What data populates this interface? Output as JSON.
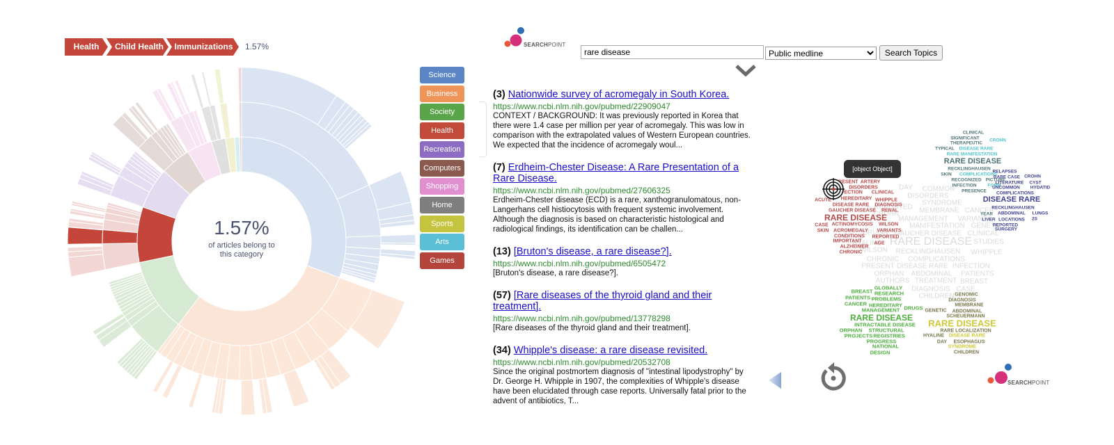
{
  "breadcrumb": {
    "items": [
      "Health",
      "Child Health",
      "Immunizations"
    ],
    "percentage": "1.57%",
    "color": "#c4463a"
  },
  "center_label": {
    "value": "1.57%",
    "caption_line1": "of articles belong to",
    "caption_line2": "this category"
  },
  "legend": [
    {
      "label": "Science",
      "color": "#5a86c5"
    },
    {
      "label": "Business",
      "color": "#f0955a"
    },
    {
      "label": "Society",
      "color": "#5aa54a"
    },
    {
      "label": "Health",
      "color": "#c24a3a"
    },
    {
      "label": "Recreation",
      "color": "#8d6dc4"
    },
    {
      "label": "Computers",
      "color": "#8a5a4e"
    },
    {
      "label": "Shopping",
      "color": "#e28fcf"
    },
    {
      "label": "Home",
      "color": "#7f7f7f"
    },
    {
      "label": "Sports",
      "color": "#c5c43e"
    },
    {
      "label": "Arts",
      "color": "#5bc0d6"
    },
    {
      "label": "Games",
      "color": "#b5443c"
    }
  ],
  "chart_data": {
    "type": "sunburst",
    "unit": "% of articles",
    "highlighted_path": [
      "Health",
      "Child Health",
      "Immunizations"
    ],
    "highlighted_value": 1.57,
    "categories": [
      {
        "name": "Science",
        "value": 30.7,
        "children": [
          {
            "v": 18.4,
            "c": [
              9.2,
              1.0,
              0.5,
              0.5,
              0.5,
              0.4,
              0.4,
              0.4,
              0.3,
              0.3
            ]
          },
          {
            "v": 6.0,
            "c": [
              3.0,
              1.2,
              0.5,
              0.4
            ]
          },
          {
            "v": 1.5,
            "c": [
              0.8,
              0.2
            ]
          },
          {
            "v": 1.0,
            "c": [
              0.5,
              0.3
            ]
          },
          0.8,
          0.7,
          0.5,
          0.4,
          0.3,
          0.3
        ]
      },
      {
        "name": "Business",
        "value": 29.7,
        "children": [
          {
            "v": 5.5,
            "c": [
              5.0
            ]
          },
          3.0,
          {
            "v": 2.5,
            "c": [
              1.2,
              0.6,
              0.4
            ]
          },
          2.0,
          {
            "v": 1.8,
            "c": [
              1.5
            ]
          },
          1.7,
          {
            "v": 1.6,
            "c": [
              0.5,
              0.4
            ]
          },
          {
            "v": 1.5,
            "c": [
              1.3
            ]
          },
          1.5,
          {
            "v": 1.4,
            "c": [
              0.4,
              0.3,
              0.3
            ]
          },
          1.4,
          {
            "v": 1.3,
            "c": [
              0.4
            ]
          },
          1.2,
          {
            "v": 1.1,
            "c": [
              0.5
            ]
          },
          {
            "v": 1.0,
            "c": [
              0.4
            ]
          },
          0.8,
          0.6,
          0.5,
          0.4,
          0.3,
          0.3,
          0.3,
          0.2,
          0.2
        ]
      },
      {
        "name": "Society",
        "value": 11.4,
        "children": [
          {
            "v": 4.2,
            "c": [
              0.3,
              0.3,
              0.3,
              0.3,
              0.3,
              0.3,
              0.3,
              0.3
            ]
          },
          {
            "v": 0.8,
            "c": [
              0.8
            ]
          },
          {
            "v": 0.6,
            "c": [
              0.5
            ]
          },
          {
            "v": 0.5,
            "c": [
              0.4
            ]
          },
          0.4,
          0.4,
          0.4,
          0.4,
          0.4,
          0.3,
          0.3,
          0.3,
          0.3,
          0.3,
          0.3
        ]
      },
      {
        "name": "Health",
        "value": 8.6,
        "hl": true,
        "children": [
          {
            "v": 3.0,
            "c": [
              1.8,
              0.5,
              0.4
            ]
          },
          {
            "v": 1.6,
            "hl": true,
            "c": [
              {
                "v": 1.57,
                "hl": true
              }
            ]
          },
          {
            "v": 1.2,
            "c": [
              0.5,
              0.3
            ]
          },
          {
            "v": 0.8,
            "c": [
              0.3,
              0.2
            ]
          },
          {
            "v": 0.6,
            "c": [
              0.2,
              0.2
            ]
          },
          0.3,
          0.3
        ]
      },
      {
        "name": "Recreation",
        "value": 6.4,
        "children": [
          {
            "v": 2.5,
            "c": [
              0.6,
              0.4,
              0.3
            ]
          },
          {
            "v": 1.2,
            "c": [
              0.3,
              0.3,
              0.2
            ]
          },
          0.6,
          0.5,
          0.4,
          0.4,
          0.3
        ]
      },
      {
        "name": "Computers",
        "value": 4.7,
        "children": [
          {
            "v": 2.0,
            "c": [
              1.2,
              0.4
            ]
          },
          {
            "v": 0.8,
            "c": [
              0.3,
              0.3
            ]
          },
          {
            "v": 0.5,
            "c": [
              0.3
            ]
          },
          0.4,
          0.4,
          0.3
        ]
      },
      {
        "name": "Shopping",
        "value": 3.9,
        "children": [
          {
            "v": 1.5,
            "c": [
              0.5,
              0.3
            ]
          },
          {
            "v": 0.8,
            "c": [
              0.4,
              0.2
            ]
          },
          {
            "v": 0.6,
            "c": [
              0.3
            ]
          },
          0.4
        ]
      },
      {
        "name": "Home",
        "value": 2.2,
        "children": [
          {
            "v": 1.0,
            "c": [
              0.3
            ]
          },
          {
            "v": 0.6,
            "c": [
              0.2
            ]
          }
        ]
      },
      {
        "name": "Sports",
        "value": 1.4,
        "children": [
          {
            "v": 0.8,
            "c": [
              0.5
            ]
          }
        ]
      },
      {
        "name": "Arts",
        "value": 0.8,
        "children": []
      },
      {
        "name": "Games",
        "value": 0.3,
        "children": [
          {
            "v": 0.3,
            "c": [
              0.3
            ]
          }
        ]
      }
    ]
  },
  "search": {
    "logo_text_bold": "SEARCH",
    "logo_text": "POINT",
    "query": "rare disease",
    "source": "Public medline",
    "button_label": "Search Topics"
  },
  "results": [
    {
      "rank": "(3)",
      "title": "Nationwide survey of acromegaly in South Korea.",
      "url": "https://www.ncbi.nlm.nih.gov/pubmed/22909047",
      "snippet": "CONTEXT / BACKGROUND: It was previously reported in Korea that there were 1.4 case per million per year of acromegaly. This was low in comparison with the extrapolated values of Western European countries. We expected that the incidence of acromegaly woul..."
    },
    {
      "rank": "(7)",
      "title": "Erdheim-Chester Disease: A Rare Presentation of a Rare Disease.",
      "url": "https://www.ncbi.nlm.nih.gov/pubmed/27606325",
      "snippet": "Erdheim-Chester disease (ECD) is a rare, xanthogranulomatous, non-Langerhans cell histiocytosis with frequent systemic involvement. Although the diagnosis is based on characteristic histological and radiological findings, its identification can be challen..."
    },
    {
      "rank": "(13)",
      "title": "[Bruton's disease, a rare disease?].",
      "url": "https://www.ncbi.nlm.nih.gov/pubmed/6505472",
      "snippet": "[Bruton's disease, a rare disease?]."
    },
    {
      "rank": "(57)",
      "title": "[Rare diseases of the thyroid gland and their treatment].",
      "url": "https://www.ncbi.nlm.nih.gov/pubmed/13778298",
      "snippet": "[Rare diseases of the thyroid gland and their treatment]."
    },
    {
      "rank": "(34)",
      "title": "Whipple's disease: a rare disease revisited.",
      "url": "https://www.ncbi.nlm.nih.gov/pubmed/20532708",
      "snippet": "Since the original postmortem diagnosis of \"intestinal lipodystrophy\" by Dr. George H. Whipple in 1907, the complexities of Whipple's disease have been elucidated through case reports. Universally fatal prior to the advent of antibiotics, T..."
    }
  ],
  "word_cloud": {
    "tooltip": "[object Object]",
    "colors": {
      "gray": "#dadada",
      "red": "#b84a4a",
      "green": "#4cae3c",
      "olive": "#77774a",
      "yellow": "#cfc93a",
      "teal": "#4e7272",
      "cyan": "#4cc4cc",
      "blue": "#3d3f92"
    },
    "gray": [
      "DAY",
      "COMMON",
      "DISORDERS",
      "SYNDROME",
      "MEMBRANE",
      "MANAGEMENT",
      "CANCER",
      "VARIANTS",
      "MANIFESTATION",
      "GENETIC",
      "GAUCHER DISEASE",
      "CLINICAL",
      "RARE DISEASE",
      "STUDIES",
      "RECKLINGHAUSEN",
      "WHIPPLE",
      "REPORTED",
      "CROHN",
      "DRUGS",
      "HYALINE",
      "WILSON",
      "CHRONIC",
      "COMPLICATIONS",
      "PRESENT",
      "DISEASE RARE",
      "INFECTION",
      "ORPHAN",
      "ABDOMINAL",
      "PATIENTS",
      "AUTHORS",
      "TREATMENT",
      "BREAST",
      "DIAGNOSIS",
      "CASE",
      "CHILDREN"
    ],
    "red": [
      "PRESENT",
      "ARTERY",
      "DISORDERS",
      "INFECTION",
      "CLINICAL",
      "ACUTE",
      "HEREDITARY",
      "WHIPPLE",
      "DISEASE RARE",
      "DIAGNOSIS",
      "GAUCHER DISEASE",
      "RENAL",
      "RARE DISEASE",
      "CASE",
      "ACTINOMYCOSIS",
      "WILSON",
      "SKIN",
      "ACROMEGALY",
      "VARIANTS",
      "CONDITIONS",
      "REPORTED",
      "IMPORTANT",
      "AGE",
      "ALZHEIMER",
      "CHRONIC"
    ],
    "green": [
      "GLOBALLY",
      "BREAST",
      "RESEARCH",
      "PATIENTS",
      "PROBLEMS",
      "CANCER",
      "HEREDITARY",
      "DRUGS",
      "MANAGEMENT",
      "RARE DISEASE",
      "INTRACTABLE DISEASE",
      "ORPHAN",
      "STRUCTURAL",
      "PROJECTS",
      "REGISTRIES",
      "PROGRESS",
      "NATIONAL",
      "DESIGN"
    ],
    "olive": [
      "GENOMIC",
      "DIAGNOSIS",
      "MEMBRANE",
      "GENETIC",
      "ABDOMINAL",
      "SCHEUERMANN",
      "RARE DISEASE",
      "RARE LOCALIZATION",
      "HYALINE",
      "DISEASE RARE",
      "DAY",
      "ESOPHAGUS",
      "SYNDROME",
      "CHILDREN"
    ],
    "teal": [
      "CLINICAL",
      "SIGNIFICANT",
      "CROHN",
      "THERAPEUTIC",
      "TYPICAL",
      "DISEASE RARE",
      "RARE MANIFESTATION",
      "RARE DISEASE",
      "RECKLINGHAUSEN",
      "SKIN",
      "COMPLICATIONS",
      "RECOGNIZED",
      "PICTURE",
      "INFECTION",
      "FORM",
      "PRESENCE"
    ],
    "blue": [
      "RELAPSES",
      "RARE CASE",
      "CROHN",
      "LITERATURE",
      "CYST",
      "UNCOMMON",
      "HYDATID",
      "COMPLICATIONS",
      "DISEASE RARE",
      "RECKLINGHAUSEN",
      "YEAR",
      "ABDOMINAL",
      "LUNGS",
      "LIVER",
      "LOCATIONS",
      "2S",
      "REPORTED",
      "SURGERY"
    ]
  }
}
